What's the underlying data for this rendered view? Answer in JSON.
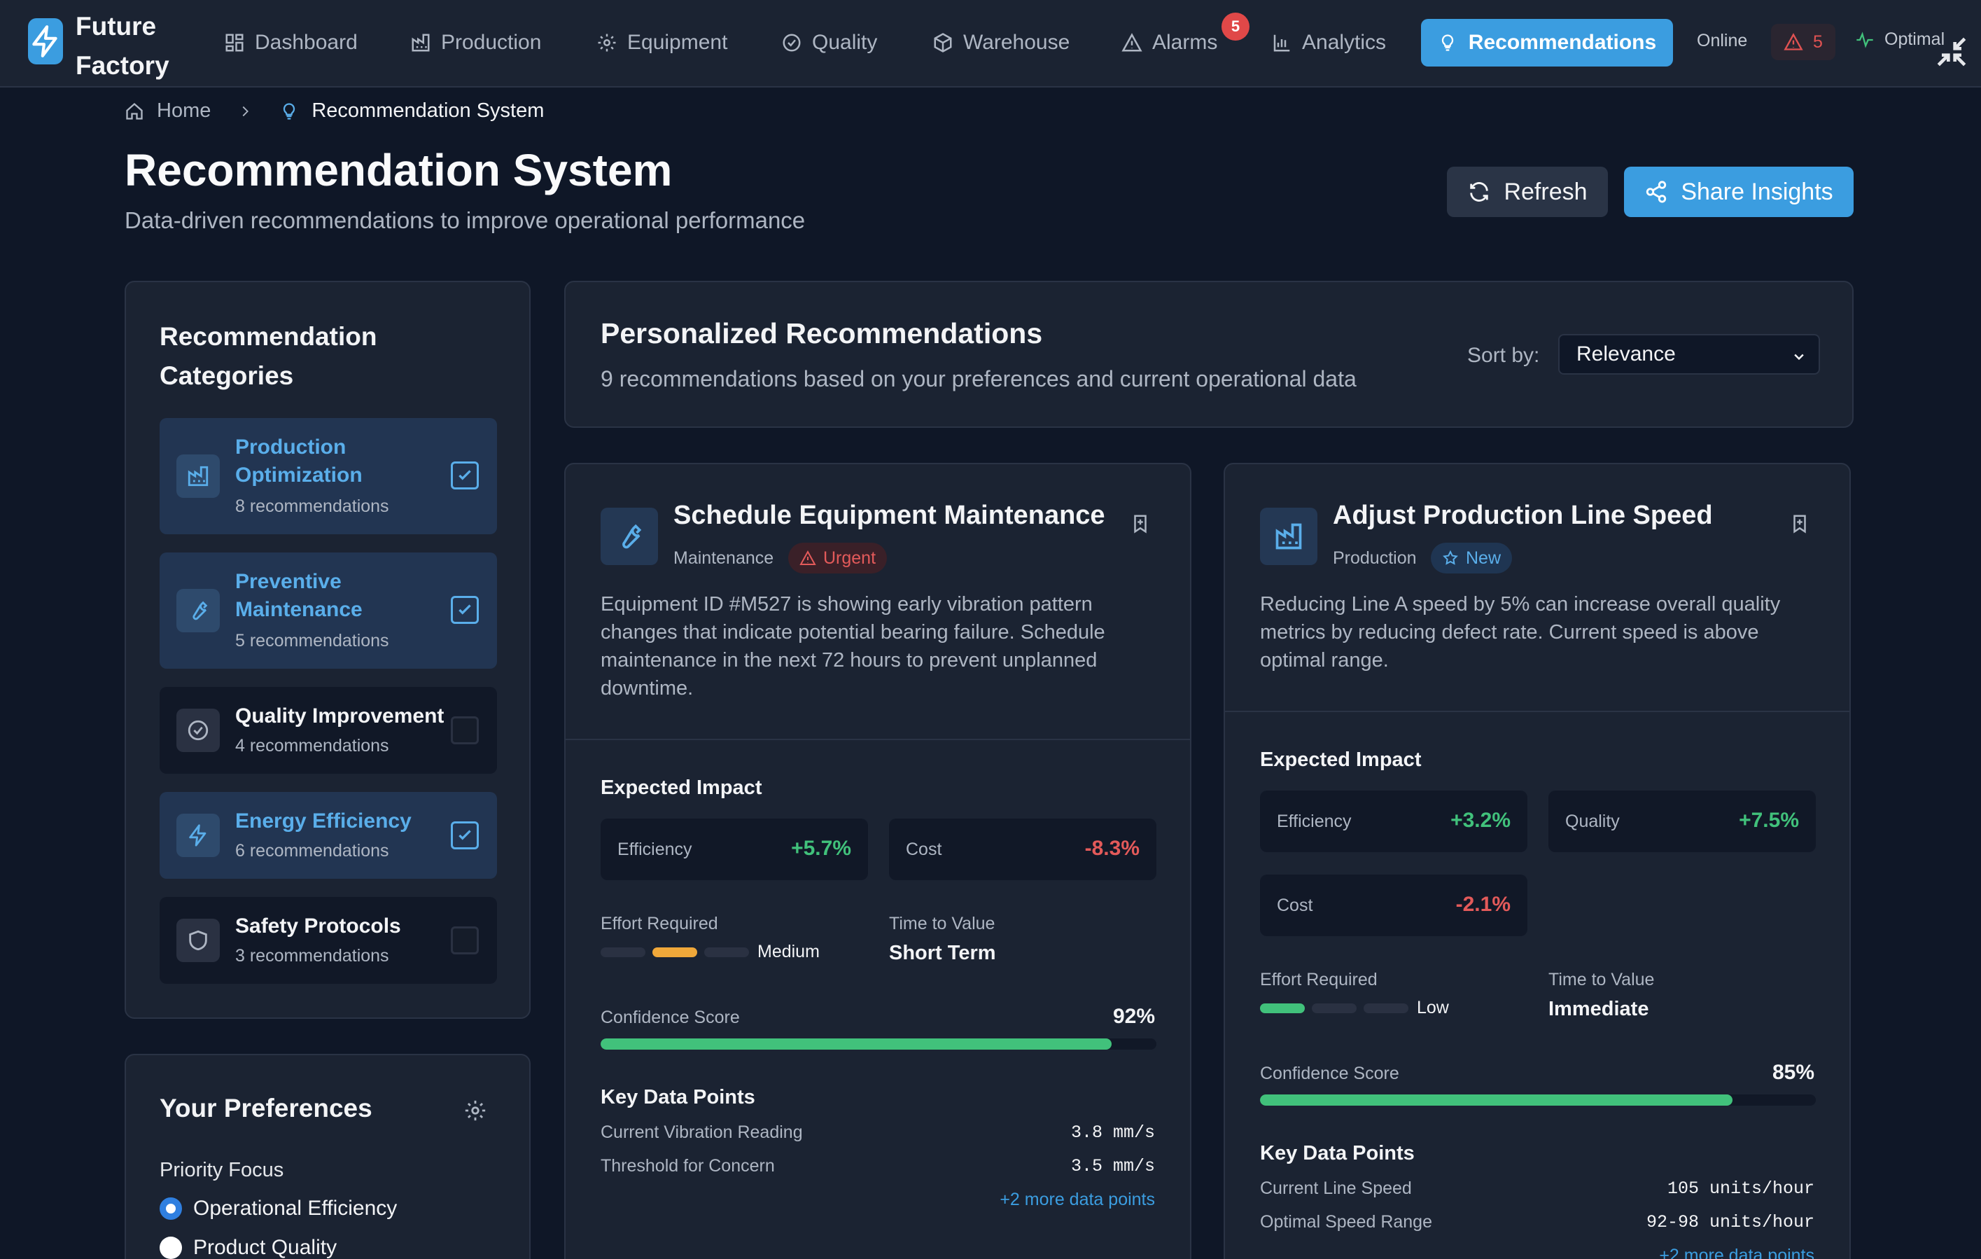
{
  "navbar": {
    "brand_line1": "Future",
    "brand_line2": "Factory",
    "items": [
      {
        "label": "Dashboard",
        "icon": "dashboard-icon"
      },
      {
        "label": "Production",
        "icon": "factory-icon"
      },
      {
        "label": "Equipment",
        "icon": "gear-icon"
      },
      {
        "label": "Quality",
        "icon": "check-circle-icon"
      },
      {
        "label": "Warehouse",
        "icon": "box-icon"
      },
      {
        "label": "Alarms",
        "icon": "warning-icon"
      },
      {
        "label": "Analytics",
        "icon": "bar-chart-icon"
      }
    ],
    "active_label": "Recommendations",
    "alarm_count": "5",
    "status_text": "Online",
    "alert_count": "5",
    "system_state": "Optimal"
  },
  "breadcrumb": {
    "home": "Home",
    "current": "Recommendation System"
  },
  "header": {
    "title": "Recommendation System",
    "subtitle": "Data-driven recommendations to improve operational performance",
    "refresh_label": "Refresh",
    "share_label": "Share Insights"
  },
  "categories": {
    "title": "Recommendation Categories",
    "items": [
      {
        "label": "Production Optimization",
        "count": "8 recommendations",
        "selected": true
      },
      {
        "label": "Preventive Maintenance",
        "count": "5 recommendations",
        "selected": true
      },
      {
        "label": "Quality Improvement",
        "count": "4 recommendations",
        "selected": false
      },
      {
        "label": "Energy Efficiency",
        "count": "6 recommendations",
        "selected": true
      },
      {
        "label": "Safety Protocols",
        "count": "3 recommendations",
        "selected": false
      }
    ]
  },
  "preferences": {
    "title": "Your Preferences",
    "priority_label": "Priority Focus",
    "options": [
      {
        "label": "Operational Efficiency",
        "selected": true
      },
      {
        "label": "Product Quality",
        "selected": false
      }
    ]
  },
  "recs": {
    "title": "Personalized Recommendations",
    "subtitle": "9 recommendations based on your preferences and current operational data",
    "sort_label": "Sort by:",
    "sort_value": "Relevance"
  },
  "cards": [
    {
      "title": "Schedule Equipment Maintenance",
      "category": "Maintenance",
      "badge": "Urgent",
      "description": "Equipment ID #M527 is showing early vibration pattern changes that indicate potential bearing failure. Schedule maintenance in the next 72 hours to prevent unplanned downtime.",
      "impact_title": "Expected Impact",
      "metrics": [
        {
          "label": "Efficiency",
          "value": "+5.7%"
        },
        {
          "label": "Cost",
          "value": "-8.3%"
        }
      ],
      "effort_label": "Effort Required",
      "effort_value": "Medium",
      "effort_level": 2,
      "ttv_label": "Time to Value",
      "ttv_value": "Short Term",
      "confidence_label": "Confidence Score",
      "confidence_value": "92%",
      "confidence": 0.92,
      "datapoints_title": "Key Data Points",
      "datapoints": [
        {
          "label": "Current Vibration Reading",
          "value": "3.8 mm/s"
        },
        {
          "label": "Threshold for Concern",
          "value": "3.5 mm/s"
        }
      ],
      "more": "+2 more data points"
    },
    {
      "title": "Adjust Production Line Speed",
      "category": "Production",
      "badge": "New",
      "description": "Reducing Line A speed by 5% can increase overall quality metrics by reducing defect rate. Current speed is above optimal range.",
      "impact_title": "Expected Impact",
      "metrics": [
        {
          "label": "Efficiency",
          "value": "+3.2%"
        },
        {
          "label": "Quality",
          "value": "+7.5%"
        },
        {
          "label": "Cost",
          "value": "-2.1%"
        }
      ],
      "effort_label": "Effort Required",
      "effort_value": "Low",
      "effort_level": 1,
      "ttv_label": "Time to Value",
      "ttv_value": "Immediate",
      "confidence_label": "Confidence Score",
      "confidence_value": "85%",
      "confidence": 0.85,
      "datapoints_title": "Key Data Points",
      "datapoints": [
        {
          "label": "Current Line Speed",
          "value": "105 units/hour"
        },
        {
          "label": "Optimal Speed Range",
          "value": "92-98 units/hour"
        }
      ],
      "more": "+2 more data points"
    }
  ],
  "colors": {
    "accent": "#3b9de0",
    "positive": "#41c17b",
    "negative": "#e35a5a",
    "warning": "#f0a83a"
  }
}
